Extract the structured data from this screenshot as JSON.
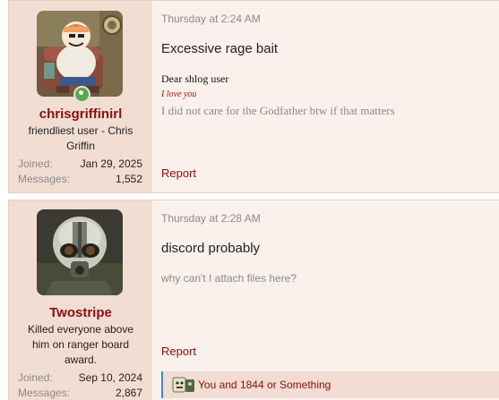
{
  "posts": [
    {
      "author": {
        "username": "chrisgriffinirl",
        "title": "friendliest user - Chris Griffin",
        "online": true,
        "avatar_icon": "cartoon-avatar-icon",
        "joined_label": "Joined:",
        "joined_value": "Jan 29, 2025",
        "messages_label": "Messages:",
        "messages_value": "1,552"
      },
      "date": "Thursday at 2:24 AM",
      "title": "Excessive rage bait",
      "body": {
        "greeting": "Dear shlog user",
        "aside": "I love you",
        "text": "I did not care for the Godfather btw if that matters"
      },
      "report_label": "Report"
    },
    {
      "author": {
        "username": "Twostripe",
        "title": "Killed everyone above him on ranger board award.",
        "avatar_icon": "helmet-soldier-avatar-icon",
        "joined_label": "Joined:",
        "joined_value": "Sep 10, 2024",
        "messages_label": "Messages:",
        "messages_value": "2,867"
      },
      "date": "Thursday at 2:28 AM",
      "title": "discord probably",
      "body": {
        "text": "why can't I attach files here?"
      },
      "report_label": "Report",
      "reactions": {
        "icon": "reaction-emoji-icon",
        "text": "You and 1844 or Something"
      }
    }
  ],
  "colors": {
    "username": "#8b0e0e",
    "post_bg": "#fbf1ec",
    "user_bg": "#f2ddd3",
    "reaction_bar": "#3b8fd6"
  }
}
